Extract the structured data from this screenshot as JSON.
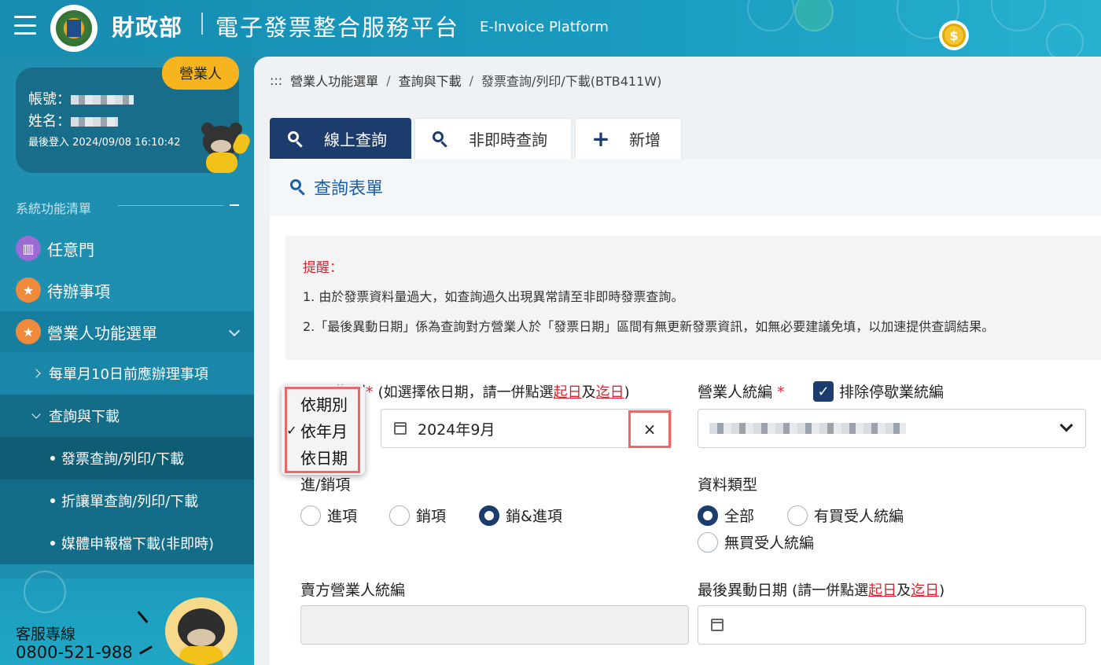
{
  "header": {
    "title": "財政部",
    "subtitle": "電子發票整合服務平台",
    "subtitle_en": "E-Invoice Platform"
  },
  "user": {
    "role": "營業人",
    "account_label": "帳號：",
    "name_label": "姓名：",
    "last_login": "最後登入 2024/09/08 16:10:42"
  },
  "sidebar": {
    "section_title": "系統功能清單",
    "items": [
      {
        "label": "任意門",
        "icon": "map-icon"
      },
      {
        "label": "待辦事項",
        "icon": "star-icon"
      },
      {
        "label": "營業人功能選單",
        "icon": "star-icon"
      }
    ],
    "sub_items": [
      {
        "label": "每單月10日前應辦理事項"
      },
      {
        "label": "查詢與下載"
      },
      {
        "label": "發票查詢/列印/下載"
      },
      {
        "label": "折讓單查詢/列印/下載"
      },
      {
        "label": "媒體申報檔下載(非即時)"
      }
    ],
    "hotline_label": "客服專線",
    "hotline_number": "0800-521-988"
  },
  "breadcrumb": {
    "prefix": ":::",
    "items": [
      "營業人功能選單",
      "查詢與下載",
      "發票查詢/列印/下載(BTB411W)"
    ]
  },
  "tabs": [
    {
      "label": "線上查詢",
      "icon": "search-icon"
    },
    {
      "label": "非即時查詢",
      "icon": "search-icon"
    },
    {
      "label": "新增",
      "icon": "plus-icon"
    }
  ],
  "form": {
    "title": "查詢表單",
    "notice_title": "提醒：",
    "notice_lines": [
      "1. 由於發票資料量過大，如查詢過久出現異常請至非即時發票查詢。",
      "2.「最後異動日期」係為查詢對方營業人於「發票日期」區間有無更新發票資訊，如無必要建議免填，以加速提供查調結果。"
    ],
    "period_label_tail": "期別",
    "period_hint_pre": "(如選擇依日期，請一併點選",
    "period_hint_start": "起日",
    "period_hint_and": "及",
    "period_hint_end": "迄日",
    "period_hint_post": ")",
    "date_value": "2024年9月",
    "clear_symbol": "×",
    "business_id_label": "營業人統編",
    "required_mark": "*",
    "exclude_label": "排除停歇業統編",
    "in_out_label": "進/銷項",
    "in_out_options": [
      "進項",
      "銷項",
      "銷&進項"
    ],
    "in_out_selected": "銷&進項",
    "data_type_label": "資料類型",
    "data_type_options": [
      "全部",
      "有買受人統編",
      "無買受人統編"
    ],
    "data_type_selected": "全部",
    "seller_id_label": "賣方營業人統編",
    "last_modified_label": "最後異動日期",
    "last_modified_hint_pre": "(請一併點選",
    "last_modified_hint_start": "起日",
    "last_modified_hint_and": "及",
    "last_modified_hint_end": "迄日",
    "last_modified_hint_post": ")"
  },
  "dropdown": {
    "options": [
      "依期別",
      "依年月",
      "依日期"
    ],
    "selected": "依年月",
    "check": "✓"
  },
  "colors": {
    "brand_blue": "#1f8fb0",
    "navy": "#1d3c6e",
    "accent_red": "#d9262f",
    "badge_yellow": "#f6b51e"
  }
}
